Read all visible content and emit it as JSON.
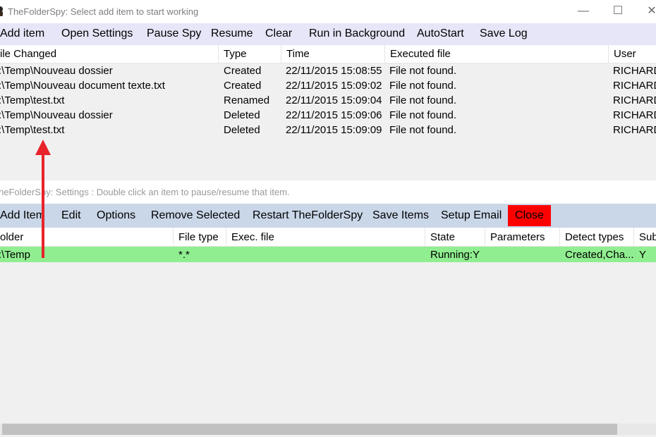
{
  "window": {
    "title": "TheFolderSpy: Select add item to start working",
    "minimize": "—",
    "maximize": "☐",
    "close": "✕"
  },
  "menu": {
    "add_item": "Add item",
    "open_settings": "Open Settings",
    "pause_spy": "Pause Spy",
    "resume": "Resume",
    "clear": "Clear",
    "run_background": "Run in Background",
    "autostart": "AutoStart",
    "save_log": "Save Log"
  },
  "log_table": {
    "headers": [
      "ile Changed",
      "Type",
      "Time",
      "Executed file",
      "User"
    ],
    "rows": [
      {
        "file": ":\\Temp\\Nouveau dossier",
        "type": "Created",
        "time": "22/11/2015 15:08:55",
        "exec": "File not found.",
        "user": "RICHARD"
      },
      {
        "file": ":\\Temp\\Nouveau document texte.txt",
        "type": "Created",
        "time": "22/11/2015 15:09:02",
        "exec": "File not found.",
        "user": "RICHARD"
      },
      {
        "file": ":\\Temp\\test.txt",
        "type": "Renamed",
        "time": "22/11/2015 15:09:04",
        "exec": "File not found.",
        "user": "RICHARD"
      },
      {
        "file": ":\\Temp\\Nouveau dossier",
        "type": "Deleted",
        "time": "22/11/2015 15:09:06",
        "exec": "File not found.",
        "user": "RICHARD"
      },
      {
        "file": ":\\Temp\\test.txt",
        "type": "Deleted",
        "time": "22/11/2015 15:09:09",
        "exec": "File not found.",
        "user": "RICHARD"
      }
    ]
  },
  "settings": {
    "title": "heFolderSpy: Settings : Double click an item to pause/resume that item.",
    "menu": {
      "add_item": "Add Item",
      "edit": "Edit",
      "options": "Options",
      "remove_selected": "Remove Selected",
      "restart": "Restart TheFolderSpy",
      "save_items": "Save Items",
      "setup_email": "Setup Email",
      "close": "Close"
    },
    "headers": [
      "older",
      "File type",
      "Exec. file",
      "State",
      "Parameters",
      "Detect types",
      "Sub"
    ],
    "row": {
      "folder": ":\\Temp",
      "file_type": "*.*",
      "exec": "",
      "state": "Running:Y",
      "parameters": "",
      "detect": "Created,Cha...",
      "sub": "Y"
    }
  },
  "colors": {
    "running_row": "#90ee90",
    "close_button": "#ff0000",
    "annotation_arrow": "#e8232a"
  }
}
